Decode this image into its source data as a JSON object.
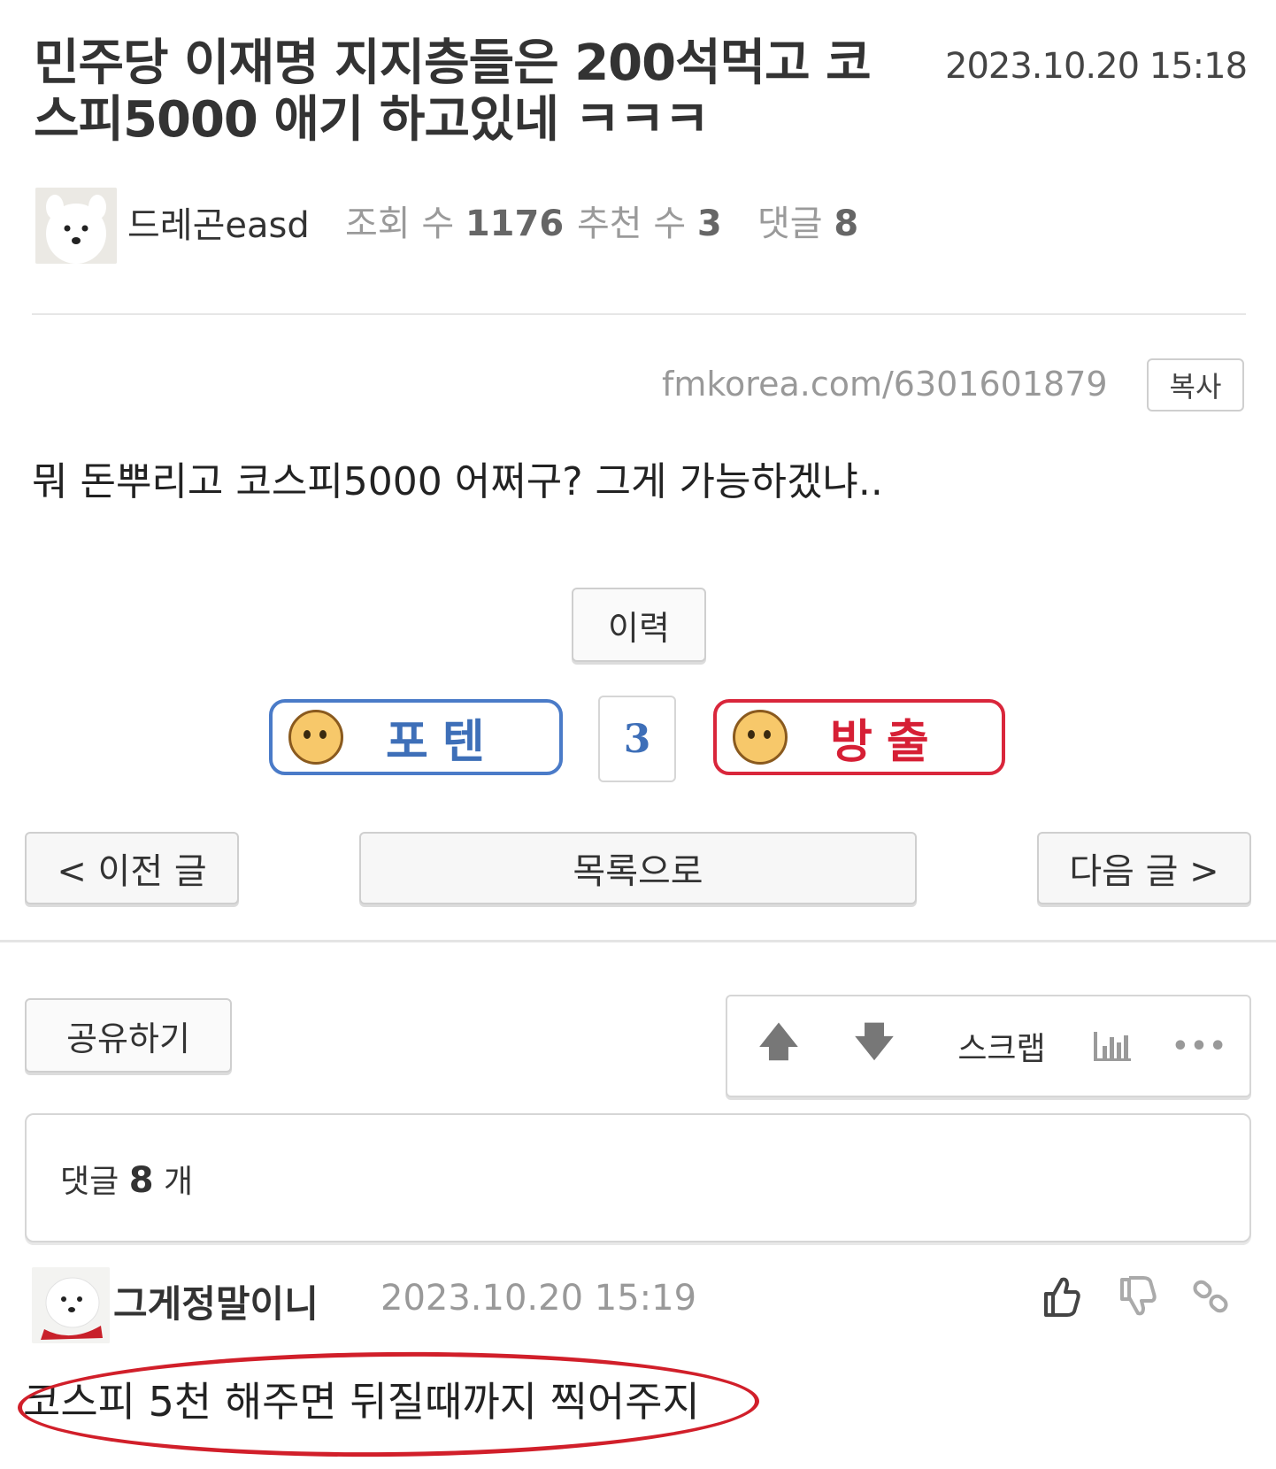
{
  "post": {
    "title_line1": "민주당 이재명 지지층들은 200석먹고 코",
    "title_line2": "스피5000 애기 하고있네 ㅋㅋㅋ",
    "date": "2023.10.20 15:18",
    "author": "드레곤easd",
    "views_label": "조회 수",
    "views": "1176",
    "recommend_label": "추천 수",
    "recommend": "3",
    "comments_label": "댓글",
    "comments": "8",
    "url": "fmkorea.com/6301601879",
    "copy_label": "복사",
    "body": "뭐 돈뿌리고 코스피5000 어쩌구?  그게 가능하겠냐.."
  },
  "actions": {
    "history_label": "이력",
    "upvote_label": "포텐",
    "vote_count": "3",
    "downvote_label": "방출",
    "prev_label": "< 이전 글",
    "list_label": "목록으로",
    "next_label": "다음 글 >",
    "share_label": "공유하기",
    "up_arrow": "🡅",
    "down_arrow": "🡇",
    "scrap_label": "스크랩",
    "more_label": "•••"
  },
  "comments_section": {
    "prefix": "댓글",
    "count": "8",
    "suffix": "개"
  },
  "comment": {
    "author": "그게정말이니",
    "date": "2023.10.20 15:19",
    "text": "코스피 5천 해주면 뒤질때까지 찍어주지"
  },
  "colors": {
    "upvote_border": "#4a7bc8",
    "downvote_border": "#d9263b",
    "highlight": "#d11f2a"
  },
  "icons": [
    "dog-avatar-icon",
    "upvote-face-icon",
    "downvote-face-icon",
    "arrow-up-icon",
    "arrow-down-icon",
    "chart-icon",
    "more-icon",
    "thumbs-up-icon",
    "thumbs-down-icon",
    "link-icon"
  ]
}
